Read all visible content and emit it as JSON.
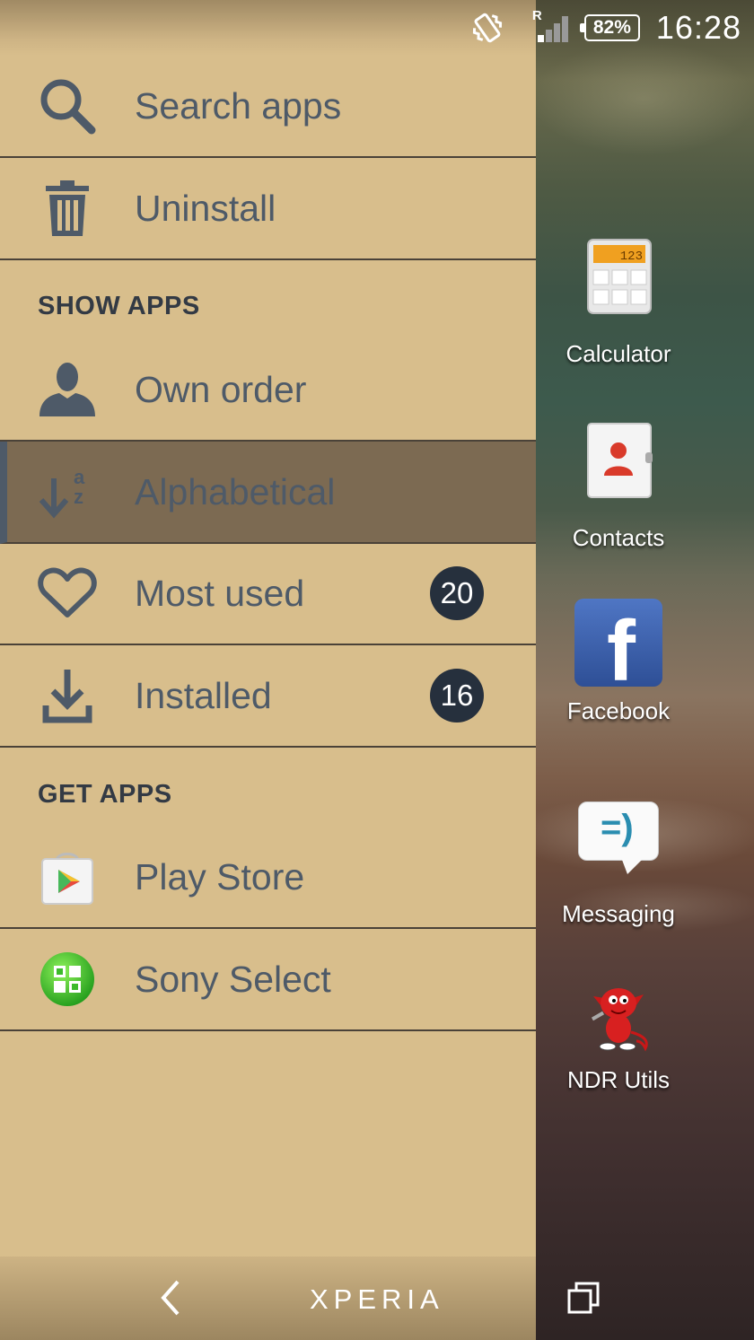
{
  "status_bar": {
    "battery": "82%",
    "time": "16:28",
    "signal_roaming": "R",
    "icons": [
      "vibrate-icon",
      "signal-icon",
      "battery-icon"
    ]
  },
  "drawer": {
    "search": {
      "label": "Search apps",
      "icon": "search-icon"
    },
    "uninstall": {
      "label": "Uninstall",
      "icon": "trash-icon"
    },
    "show_apps_header": "SHOW APPS",
    "own_order": {
      "label": "Own order",
      "icon": "person-icon"
    },
    "alphabetical": {
      "label": "Alphabetical",
      "icon": "sort-az-icon",
      "selected": true
    },
    "most_used": {
      "label": "Most used",
      "icon": "heart-icon",
      "badge": "20"
    },
    "installed": {
      "label": "Installed",
      "icon": "download-icon",
      "badge": "16"
    },
    "get_apps_header": "GET APPS",
    "play_store": {
      "label": "Play Store",
      "icon": "play-store-icon"
    },
    "sony_select": {
      "label": "Sony Select",
      "icon": "sony-select-icon"
    }
  },
  "apps": [
    {
      "label": "Calculator",
      "icon": "calculator-icon",
      "display": "123"
    },
    {
      "label": "Contacts",
      "icon": "contacts-icon"
    },
    {
      "label": "Facebook",
      "icon": "facebook-icon",
      "glyph": "f"
    },
    {
      "label": "Messaging",
      "icon": "messaging-icon",
      "glyph": "=)"
    },
    {
      "label": "NDR Utils",
      "icon": "devil-mascot-icon"
    }
  ],
  "nav_bar": {
    "brand": "XPERIA",
    "icons": [
      "back-icon",
      "recent-apps-icon"
    ]
  },
  "colors": {
    "drawer_bg": "#d8be8c",
    "selected_bg": "#7c6a52",
    "text": "#4e5a68",
    "header_text": "#333a44",
    "badge_bg": "#26303d",
    "divider": "#4a4238"
  }
}
